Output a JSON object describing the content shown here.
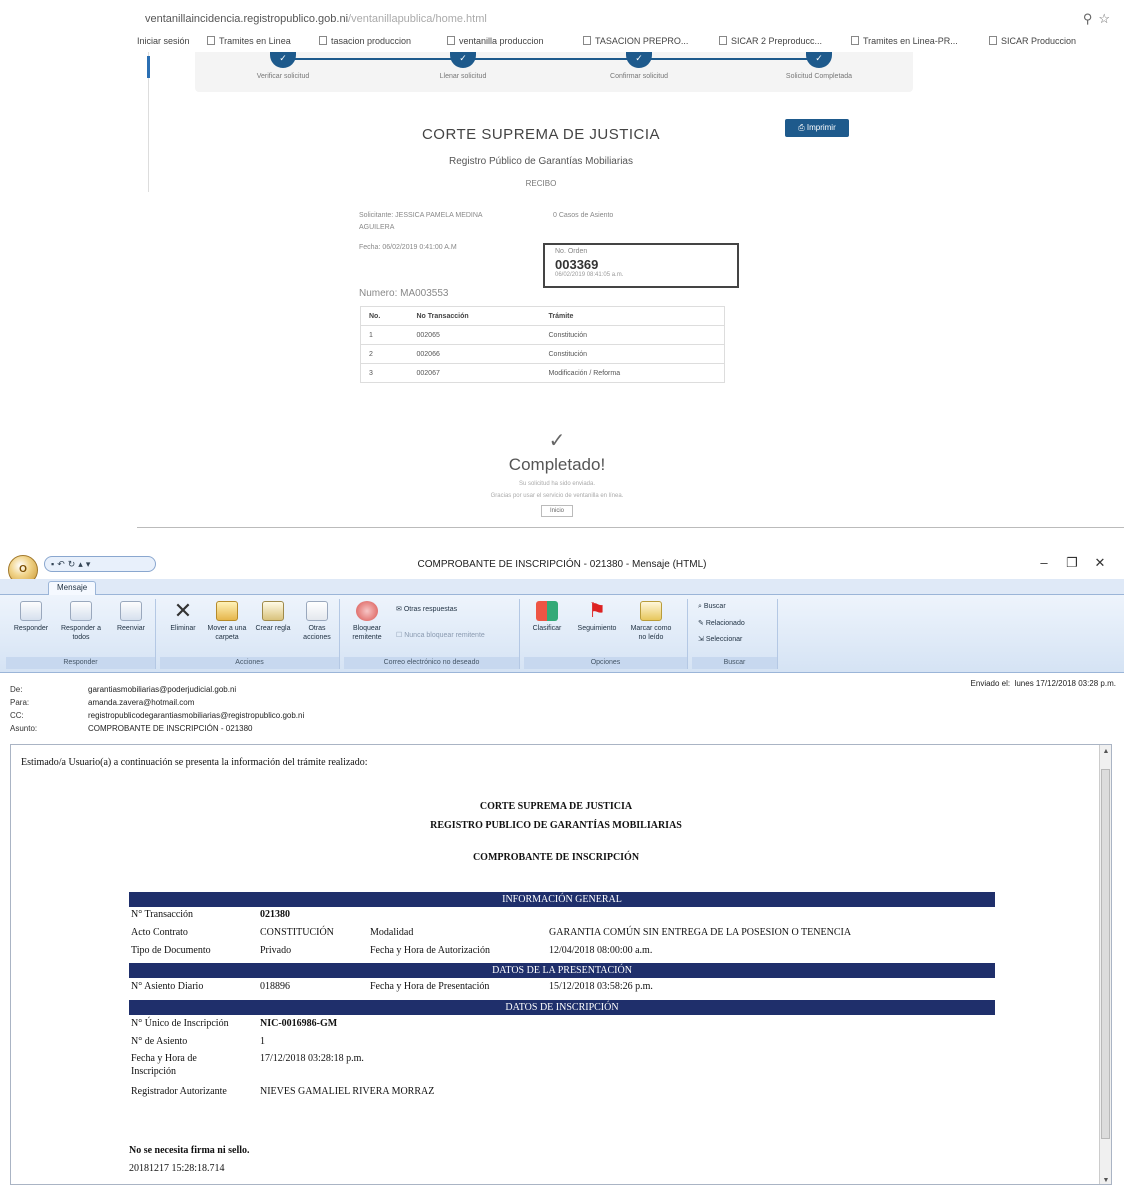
{
  "browser": {
    "url_main": "ventanillaincidencia.registropublico.gob.ni",
    "url_path": "/ventanillapublica/home.html",
    "bookmarks": [
      "Iniciar sesión",
      "Tramites en Linea",
      "tasacion produccion",
      "ventanilla produccion",
      "TASACION PREPRO...",
      "SICAR 2 Preproducc...",
      "Tramites en Linea-PR...",
      "SICAR Produccion"
    ],
    "steps": [
      {
        "icon": "✓",
        "label": "Verificar solicitud"
      },
      {
        "icon": "✓",
        "label": "Llenar solicitud"
      },
      {
        "icon": "✓",
        "label": "Confirmar solicitud"
      },
      {
        "icon": "✓",
        "label": "Solicitud Completada"
      }
    ],
    "receipt": {
      "court": "CORTE SUPREMA DE JUSTICIA",
      "registry": "Registro Público de Garantías Mobiliarias",
      "recibo": "RECIBO",
      "print_label": "Imprimir",
      "solicitante_1": "Solicitante: JESSICA PAMELA MEDINA",
      "solicitante_2": "AGUILERA",
      "caso": "0 Casos de Asiento",
      "fecha": "Fecha: 06/02/2019 0:41:00 A.M",
      "order_caption": "No. Orden",
      "order_number": "003369",
      "order_date": "06/02/2019 08:41:05 a.m.",
      "numero": "Numero: MA003553",
      "table": {
        "headers": [
          "No.",
          "No Transacción",
          "Trámite"
        ],
        "rows": [
          [
            "1",
            "002065",
            "Constitución"
          ],
          [
            "2",
            "002066",
            "Constitución"
          ],
          [
            "3",
            "002067",
            "Modificación / Reforma"
          ]
        ]
      },
      "check": "✓",
      "done_title": "Completado!",
      "done_sub1": "Su solicitud ha sido enviada.",
      "done_sub2": "Gracias por usar el servicio de ventanilla en línea.",
      "done_button": "Inicio"
    }
  },
  "outlook": {
    "window_title": "COMPROBANTE DE INSCRIPCIÓN - 021380 - Mensaje (HTML)",
    "tab": "Mensaje",
    "ribbon": {
      "responder": {
        "label": "Responder",
        "buttons": [
          "Responder",
          "Responder a todos",
          "Reenviar"
        ]
      },
      "acciones": {
        "label": "Acciones",
        "buttons": [
          "Eliminar",
          "Mover a una carpeta",
          "Crear regla",
          "Otras acciones"
        ]
      },
      "correo": {
        "label": "Correo electrónico no deseado",
        "buttons": [
          "Bloquear remitente"
        ],
        "other_label": "Otras respuestas",
        "never_label": "Nunca bloquear remitente"
      },
      "opciones": {
        "label": "Opciones",
        "buttons": [
          "Clasificar",
          "Seguimiento",
          "Marcar como no leído"
        ]
      },
      "buscar": {
        "label": "Buscar",
        "items": [
          "Buscar",
          "Relacionado",
          "Seleccionar"
        ]
      }
    },
    "headers": {
      "de_label": "De:",
      "de": "garantiasmobiliarias@poderjudicial.gob.ni",
      "para_label": "Para:",
      "para": "amanda.zavera@hotmail.com",
      "cc_label": "CC:",
      "cc": "registropublicodegarantiasmobiliarias@registropublico.gob.ni",
      "asunto_label": "Asunto:",
      "asunto": "COMPROBANTE DE INSCRIPCIÓN - 021380",
      "sent_label": "Enviado el:",
      "sent": "lunes 17/12/2018 03:28 p.m."
    },
    "body": {
      "greeting": "Estimado/a Usuario(a) a continuación se presenta la información del trámite realizado:",
      "title1": "CORTE SUPREMA DE JUSTICIA",
      "title2": "REGISTRO PUBLICO DE GARANTÍAS MOBILIARIAS",
      "title3": "COMPROBANTE DE INSCRIPCIÓN",
      "banner_general": "INFORMACIÓN GENERAL",
      "banner_presentacion": "DATOS DE LA PRESENTACIÓN",
      "banner_inscripcion": "DATOS DE INSCRIPCIÓN",
      "transaccion_label": "N° Transacción",
      "transaccion": "021380",
      "acto_label": "Acto Contrato",
      "acto": "CONSTITUCIÓN",
      "modalidad_label": "Modalidad",
      "modalidad": "GARANTIA COMÚN SIN ENTREGA DE LA POSESION O TENENCIA",
      "tipo_label": "Tipo de Documento",
      "tipo": "Privado",
      "autorizacion_label": "Fecha y Hora de Autorización",
      "autorizacion": "12/04/2018 08:00:00 a.m.",
      "asiento_diario_label": "N° Asiento Diario",
      "asiento_diario": "018896",
      "presentacion_label": "Fecha y Hora de Presentación",
      "presentacion": "15/12/2018 03:58:26 p.m.",
      "unico_label": "N° Único de Inscripción",
      "unico": "NIC-0016986-GM",
      "num_asiento_label": "N° de Asiento",
      "num_asiento": "1",
      "fecha_insc_label_1": "Fecha y Hora de",
      "fecha_insc_label_2": "Inscripción",
      "fecha_insc": "17/12/2018 03:28:18 p.m.",
      "registrador_label": "Registrador Autorizante",
      "registrador": "NIEVES GAMALIEL RIVERA MORRAZ",
      "no_firma": "No se necesita firma ni sello.",
      "stamp": "20181217 15:28:18.714"
    }
  }
}
